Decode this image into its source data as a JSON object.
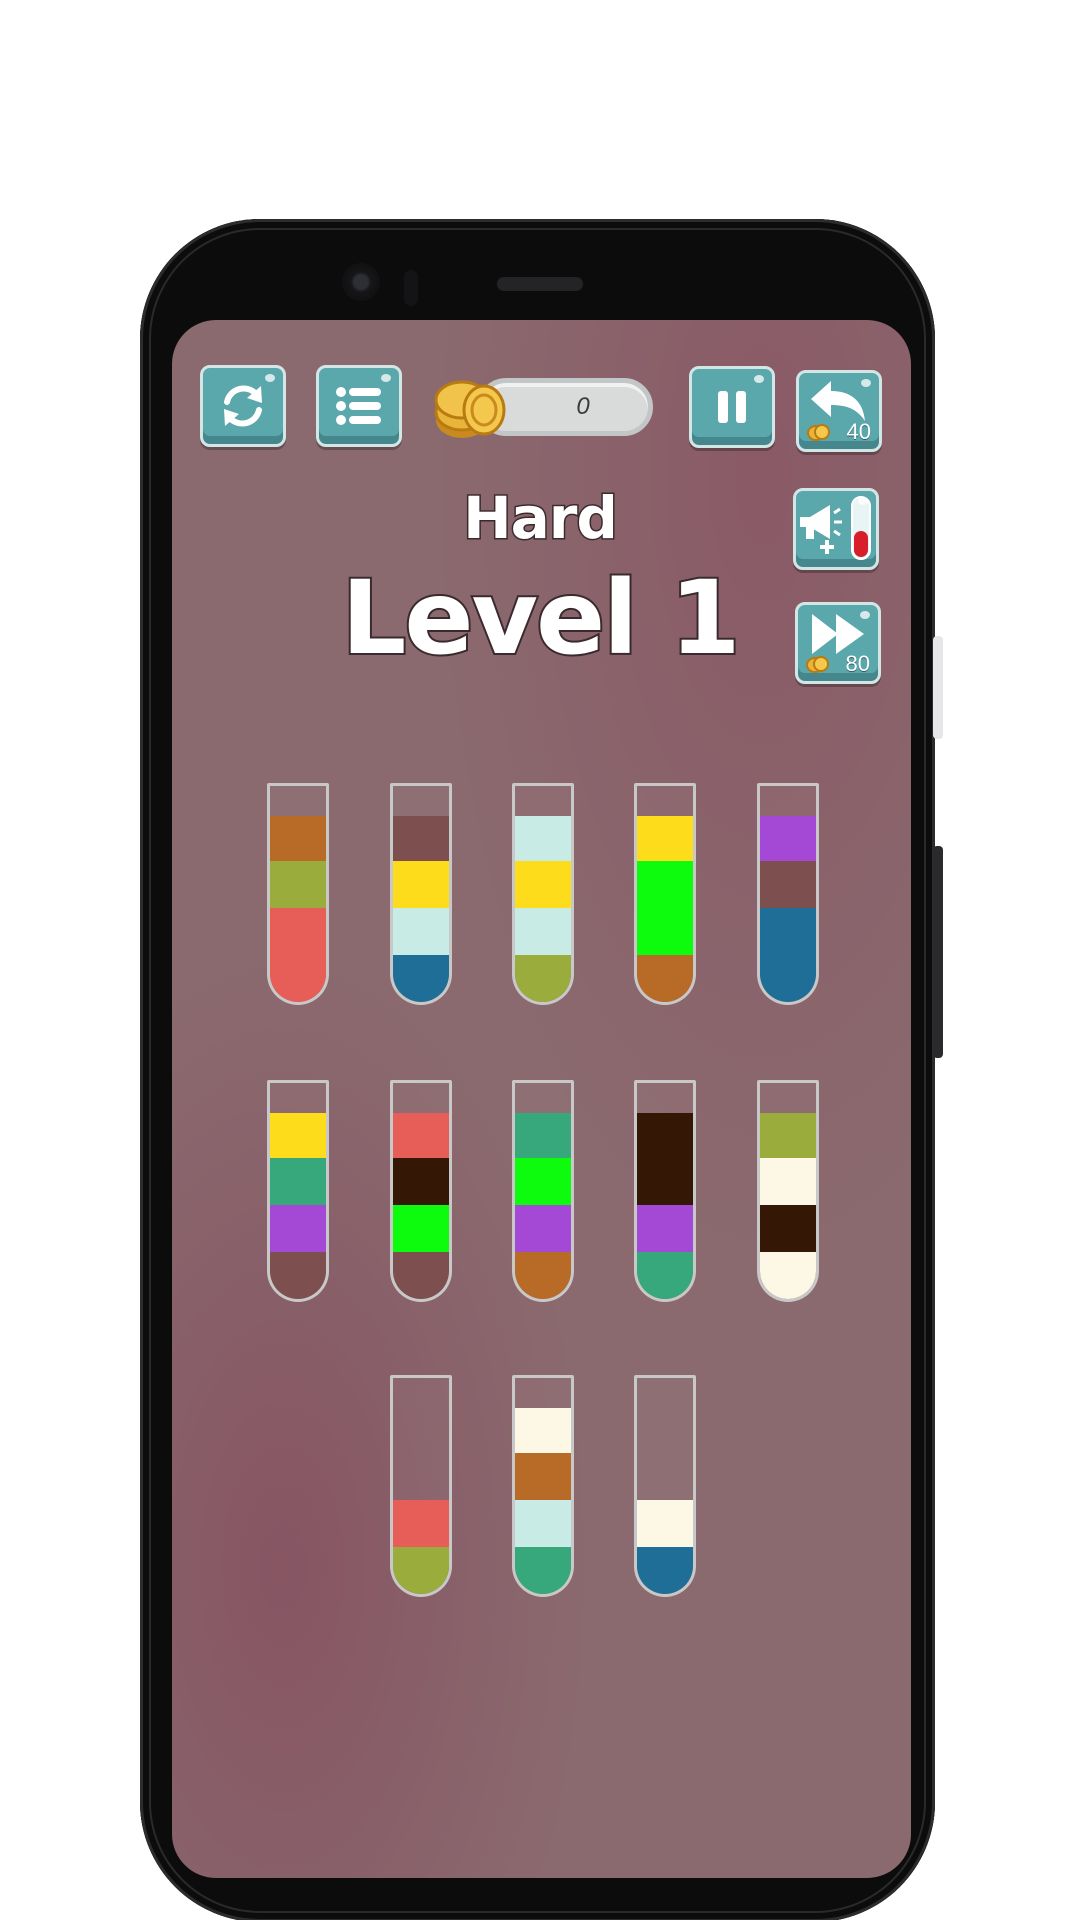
{
  "header": {
    "coins": "0",
    "undo_cost": "40",
    "skip_cost": "80",
    "icons": {
      "restart": "restart-icon",
      "menu": "list-menu-icon",
      "coin": "coin-stack-icon",
      "pause": "pause-icon",
      "undo": "undo-arrow-icon",
      "add_tube": "megaphone-add-tube-icon",
      "skip": "fast-forward-icon"
    }
  },
  "title": {
    "difficulty": "Hard",
    "level": "Level 1"
  },
  "colors": {
    "brown": "#b86b27",
    "olive": "#9aac3c",
    "red": "#e65e57",
    "mauve": "#7e4f4f",
    "yellow": "#fddd1b",
    "mint": "#c8ebe5",
    "blue": "#1f6e97",
    "green": "#0dfc0d",
    "purple": "#a449d6",
    "teal": "#36a87c",
    "darkbrown": "#351706",
    "cream": "#fdf8e6"
  },
  "tubes": [
    {
      "layers_bottom_to_top": [
        "red",
        "red",
        "olive",
        "brown"
      ]
    },
    {
      "layers_bottom_to_top": [
        "blue",
        "mint",
        "yellow",
        "mauve"
      ]
    },
    {
      "layers_bottom_to_top": [
        "olive",
        "mint",
        "yellow",
        "mint"
      ]
    },
    {
      "layers_bottom_to_top": [
        "brown",
        "green",
        "green",
        "yellow"
      ]
    },
    {
      "layers_bottom_to_top": [
        "blue",
        "blue",
        "mauve",
        "purple"
      ]
    },
    {
      "layers_bottom_to_top": [
        "mauve",
        "purple",
        "teal",
        "yellow"
      ]
    },
    {
      "layers_bottom_to_top": [
        "mauve",
        "green",
        "darkbrown",
        "red"
      ]
    },
    {
      "layers_bottom_to_top": [
        "brown",
        "purple",
        "green",
        "teal"
      ]
    },
    {
      "layers_bottom_to_top": [
        "teal",
        "purple",
        "darkbrown",
        "darkbrown"
      ]
    },
    {
      "layers_bottom_to_top": [
        "cream",
        "darkbrown",
        "cream",
        "olive"
      ]
    },
    {
      "layers_bottom_to_top": [
        "olive",
        "red"
      ]
    },
    {
      "layers_bottom_to_top": [
        "teal",
        "mint",
        "brown",
        "cream"
      ]
    },
    {
      "layers_bottom_to_top": [
        "blue",
        "cream"
      ]
    }
  ]
}
